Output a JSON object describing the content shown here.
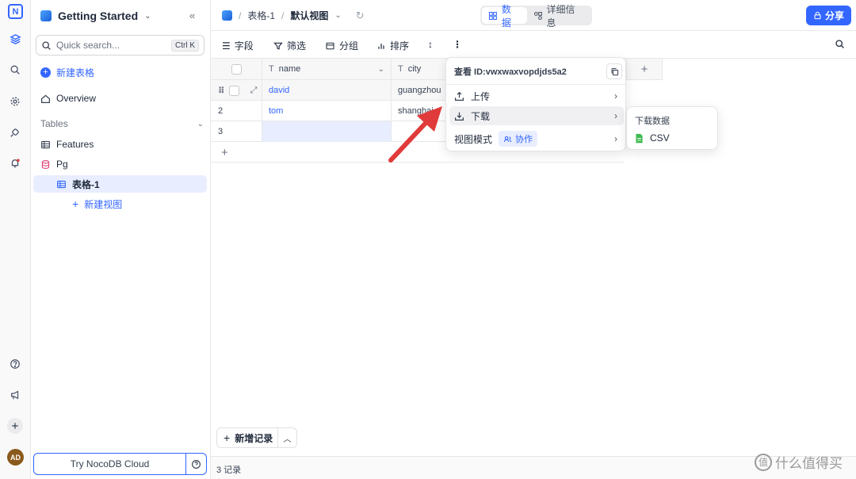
{
  "sidebar": {
    "workspace": "Getting Started",
    "search_placeholder": "Quick search...",
    "search_shortcut": "Ctrl K",
    "new_table": "新建表格",
    "overview": "Overview",
    "tables_header": "Tables",
    "items": [
      {
        "label": "Features"
      },
      {
        "label": "Pg"
      },
      {
        "label": "表格-1"
      },
      {
        "label": "新建视图"
      }
    ],
    "try_cloud": "Try NocoDB Cloud",
    "avatar": "AD"
  },
  "topbar": {
    "table": "表格-1",
    "view": "默认视图",
    "tab_data": "数据",
    "tab_details": "详细信息",
    "share": "分享"
  },
  "toolbar": {
    "fields": "字段",
    "filter": "筛选",
    "group": "分组",
    "sort": "排序"
  },
  "grid": {
    "columns": [
      "name",
      "city"
    ],
    "rows": [
      {
        "num": "",
        "name": "david",
        "city": "guangzhou"
      },
      {
        "num": "2",
        "name": "tom",
        "city": "shanghai"
      },
      {
        "num": "3",
        "name": "",
        "city": ""
      }
    ],
    "new_record": "新增记录",
    "record_count": "3 记录"
  },
  "menu": {
    "view_id": "查看 ID:vwxwaxvopdjds5a2",
    "upload": "上传",
    "download": "下载",
    "view_mode": "视图模式",
    "view_mode_tag": "协作"
  },
  "submenu": {
    "header": "下载数据",
    "csv": "CSV"
  },
  "watermark": "值 什么值得买",
  "colors": {
    "accent": "#3366ff",
    "arrow": "#e03a3a"
  }
}
